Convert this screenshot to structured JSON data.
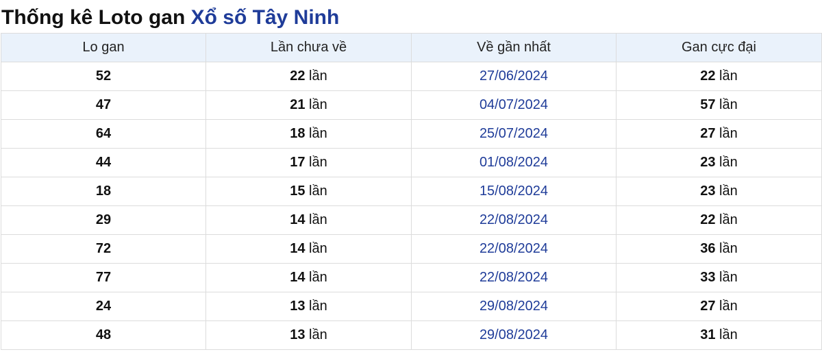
{
  "title": {
    "prefix": "Thống kê Loto gan ",
    "accent": "Xổ số Tây Ninh"
  },
  "colors": {
    "accent": "#1f3c99",
    "header_bg": "#eaf2fb",
    "border": "#dcdcdc"
  },
  "table": {
    "headers": [
      "Lo gan",
      "Lần chưa về",
      "Về gần nhất",
      "Gan cực đại"
    ],
    "unit": "lần",
    "rows": [
      {
        "number": "52",
        "missed": "22",
        "last_seen": "27/06/2024",
        "max_gap": "22"
      },
      {
        "number": "47",
        "missed": "21",
        "last_seen": "04/07/2024",
        "max_gap": "57"
      },
      {
        "number": "64",
        "missed": "18",
        "last_seen": "25/07/2024",
        "max_gap": "27"
      },
      {
        "number": "44",
        "missed": "17",
        "last_seen": "01/08/2024",
        "max_gap": "23"
      },
      {
        "number": "18",
        "missed": "15",
        "last_seen": "15/08/2024",
        "max_gap": "23"
      },
      {
        "number": "29",
        "missed": "14",
        "last_seen": "22/08/2024",
        "max_gap": "22"
      },
      {
        "number": "72",
        "missed": "14",
        "last_seen": "22/08/2024",
        "max_gap": "36"
      },
      {
        "number": "77",
        "missed": "14",
        "last_seen": "22/08/2024",
        "max_gap": "33"
      },
      {
        "number": "24",
        "missed": "13",
        "last_seen": "29/08/2024",
        "max_gap": "27"
      },
      {
        "number": "48",
        "missed": "13",
        "last_seen": "29/08/2024",
        "max_gap": "31"
      }
    ]
  }
}
